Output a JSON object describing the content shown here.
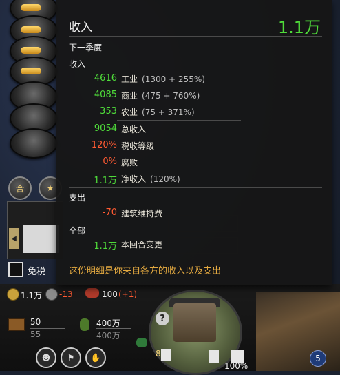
{
  "tooltip": {
    "title": "收入",
    "total": "1.1万",
    "subtitle": "下一季度",
    "income_label": "收入",
    "income_rows": [
      {
        "value": "4616",
        "label": "工业",
        "detail": "(1300 + 255%)"
      },
      {
        "value": "4085",
        "label": "商业",
        "detail": "(475 + 760%)"
      },
      {
        "value": "353",
        "label": "农业",
        "detail": "(75 + 371%)"
      }
    ],
    "summary_rows": [
      {
        "value": "9054",
        "label": "总收入",
        "detail": "",
        "color": "#4fdc3a"
      },
      {
        "value": "120%",
        "label": "税收等级",
        "detail": "",
        "color": "#ff5a32"
      },
      {
        "value": "0%",
        "label": "腐败",
        "detail": "",
        "color": "#ff5a32"
      },
      {
        "value": "1.1万",
        "label": "净收入",
        "detail": "(120%)",
        "color": "#4fdc3a"
      }
    ],
    "expense_label": "支出",
    "expense_rows": [
      {
        "value": "-70",
        "label": "建筑维持费",
        "detail": "",
        "color": "#ff5a32"
      }
    ],
    "all_label": "全部",
    "all_rows": [
      {
        "value": "1.1万",
        "label": "本回合变更",
        "detail": "",
        "color": "#4fdc3a"
      }
    ],
    "note": "这份明细是你来自各方的收入以及支出"
  },
  "sidebar": {
    "btn_he": "合",
    "tax_exempt_label": "免税"
  },
  "resources": {
    "gold": "1.1万",
    "food_change": "-13",
    "supply": "100",
    "supply_change": "(+1)",
    "troops_current": "50",
    "troops_max": "55",
    "pop_current": "400万",
    "pop_max": "400万"
  },
  "city": {
    "help": "?",
    "building_count": "8",
    "percent": "100%",
    "turn_badge": "5"
  },
  "colors": {
    "positive": "#4fdc3a",
    "negative": "#ff5a32",
    "note": "#e2a840"
  }
}
